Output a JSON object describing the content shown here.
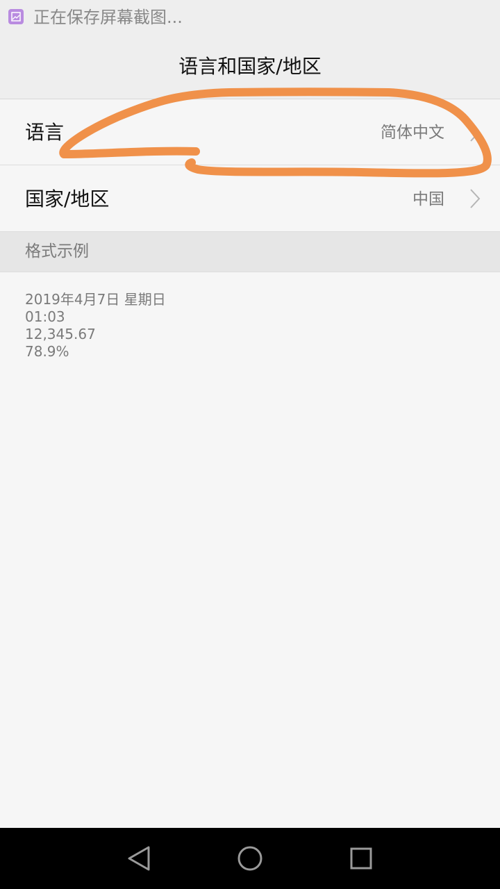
{
  "status_bar": {
    "text": "正在保存屏幕截图...",
    "icon": "screenshot-icon"
  },
  "title": "语言和国家/地区",
  "rows": [
    {
      "label": "语言",
      "value": "简体中文"
    },
    {
      "label": "国家/地区",
      "value": "中国"
    }
  ],
  "section": {
    "header": "格式示例",
    "examples": {
      "date": "2019年4月7日 星期日",
      "time": "01:03",
      "number": "12,345.67",
      "percent": "78.9%"
    }
  },
  "nav_bar": {
    "back_icon": "triangle-back-icon",
    "home_icon": "circle-home-icon",
    "recent_icon": "square-recents-icon"
  },
  "colors": {
    "annotation_stroke": "#f0914a",
    "background": "#f6f6f6",
    "title_bar": "#eeeeee",
    "section_header": "#e6e6e6"
  }
}
